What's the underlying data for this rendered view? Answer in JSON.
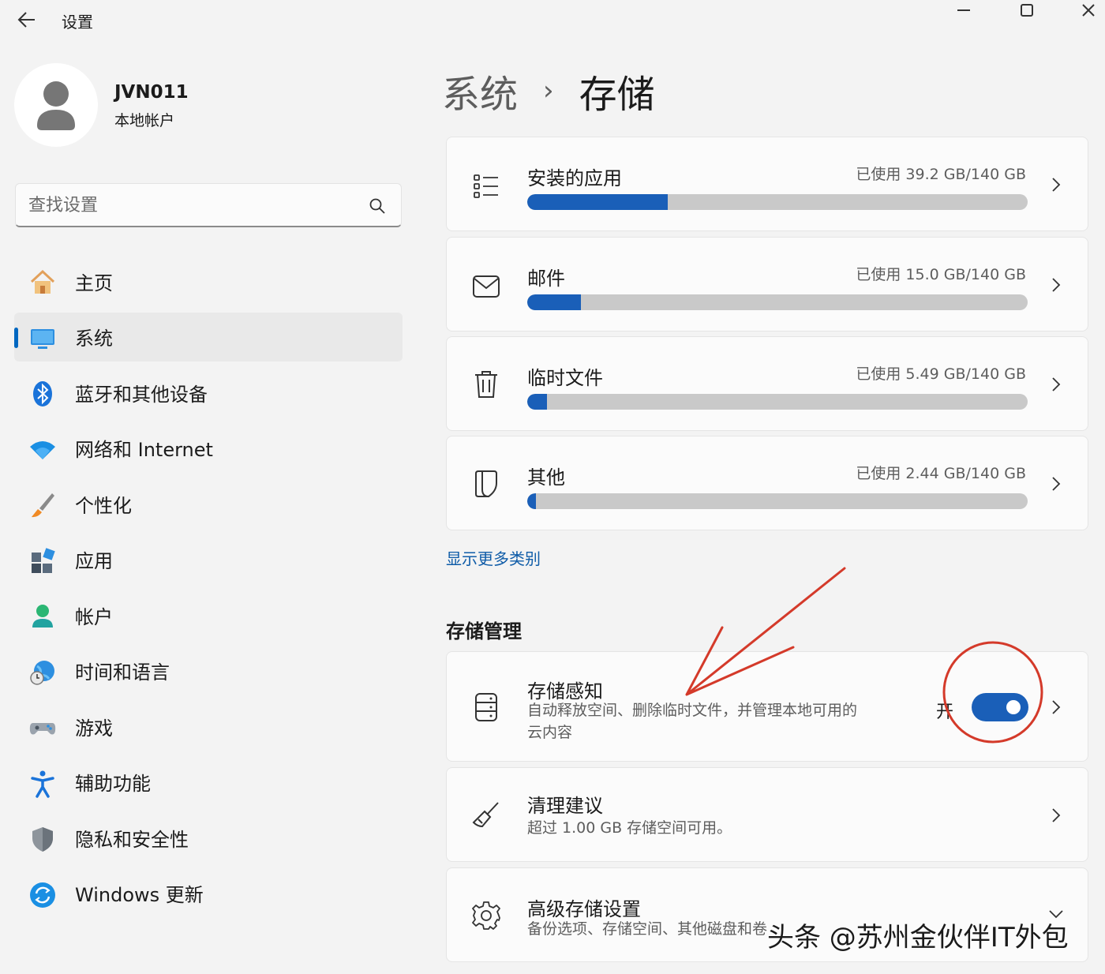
{
  "window": {
    "title": "设置"
  },
  "user": {
    "name": "JVN011",
    "account_type": "本地帐户"
  },
  "search": {
    "placeholder": "查找设置"
  },
  "sidebar": {
    "items": [
      {
        "label": "主页",
        "icon": "home-icon",
        "active": false
      },
      {
        "label": "系统",
        "icon": "monitor-icon",
        "active": true
      },
      {
        "label": "蓝牙和其他设备",
        "icon": "bluetooth-icon",
        "active": false
      },
      {
        "label": "网络和 Internet",
        "icon": "wifi-icon",
        "active": false
      },
      {
        "label": "个性化",
        "icon": "brush-icon",
        "active": false
      },
      {
        "label": "应用",
        "icon": "apps-icon",
        "active": false
      },
      {
        "label": "帐户",
        "icon": "account-icon",
        "active": false
      },
      {
        "label": "时间和语言",
        "icon": "globe-clock-icon",
        "active": false
      },
      {
        "label": "游戏",
        "icon": "gamepad-icon",
        "active": false
      },
      {
        "label": "辅助功能",
        "icon": "accessibility-icon",
        "active": false
      },
      {
        "label": "隐私和安全性",
        "icon": "shield-icon",
        "active": false
      },
      {
        "label": "Windows 更新",
        "icon": "update-icon",
        "active": false
      }
    ]
  },
  "breadcrumb": {
    "parent": "系统",
    "separator": "›",
    "current": "存储"
  },
  "storage_categories": [
    {
      "title": "安装的应用",
      "usage": "已使用 39.2 GB/140 GB",
      "fraction": 0.28,
      "icon": "list-icon"
    },
    {
      "title": "邮件",
      "usage": "已使用 15.0 GB/140 GB",
      "fraction": 0.107,
      "icon": "mail-icon"
    },
    {
      "title": "临时文件",
      "usage": "已使用 5.49 GB/140 GB",
      "fraction": 0.039,
      "icon": "trash-icon"
    },
    {
      "title": "其他",
      "usage": "已使用 2.44 GB/140 GB",
      "fraction": 0.017,
      "icon": "document-icon"
    }
  ],
  "show_more": "显示更多类别",
  "management": {
    "section_title": "存储管理",
    "storage_sense": {
      "title": "存储感知",
      "desc_line1": "自动释放空间、删除临时文件，并管理本地可用的",
      "desc_line2": "云内容",
      "toggle_label": "开",
      "toggle_on": true,
      "icon": "drive-icon"
    },
    "cleanup": {
      "title": "清理建议",
      "desc": "超过 1.00 GB 存储空间可用。",
      "icon": "broom-icon"
    },
    "advanced": {
      "title": "高级存储设置",
      "desc": "备份选项、存储空间、其他磁盘和卷",
      "icon": "gear-icon"
    }
  },
  "watermark": "头条 @苏州金伙伴IT外包",
  "colors": {
    "accent": "#1a5fb8",
    "annotation": "#d43a2a"
  }
}
